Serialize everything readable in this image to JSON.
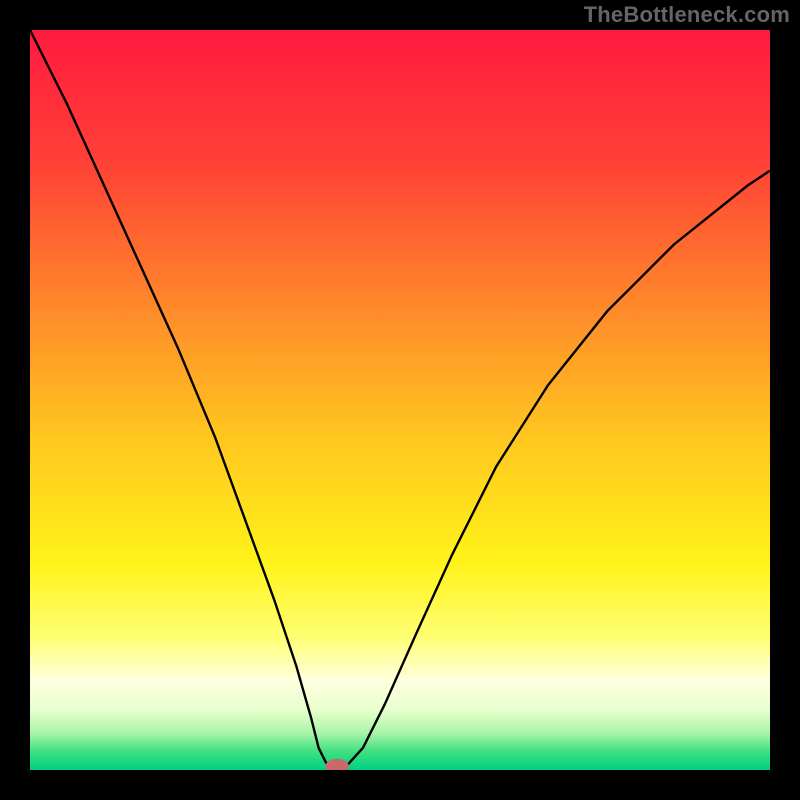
{
  "watermark": "TheBottleneck.com",
  "chart_data": {
    "type": "line",
    "title": "",
    "xlabel": "",
    "ylabel": "",
    "xlim": [
      0,
      100
    ],
    "ylim": [
      0,
      100
    ],
    "grid": false,
    "legend": false,
    "series": [
      {
        "name": "curve",
        "color": "#000000",
        "x": [
          0,
          5,
          10,
          15,
          20,
          25,
          29,
          33,
          36,
          38,
          39,
          40,
          41,
          42,
          43,
          45,
          48,
          52,
          57,
          63,
          70,
          78,
          87,
          97,
          100
        ],
        "y": [
          100,
          90,
          79,
          68,
          57,
          45,
          34,
          23,
          14,
          7,
          3,
          1,
          0.5,
          0.5,
          0.8,
          3,
          9,
          18,
          29,
          41,
          52,
          62,
          71,
          79,
          81
        ]
      }
    ],
    "marker": {
      "name": "highlight",
      "x": 41.5,
      "y": 0.5,
      "rx": 1.6,
      "ry": 1.0,
      "color": "#c86a6a"
    },
    "background_gradient": {
      "stops": [
        {
          "offset": 0.0,
          "color": "#ff1a3f"
        },
        {
          "offset": 0.18,
          "color": "#ff4136"
        },
        {
          "offset": 0.38,
          "color": "#ff8b2a"
        },
        {
          "offset": 0.55,
          "color": "#ffc61f"
        },
        {
          "offset": 0.72,
          "color": "#fff319"
        },
        {
          "offset": 0.82,
          "color": "#ffff73"
        },
        {
          "offset": 0.88,
          "color": "#ffffe0"
        },
        {
          "offset": 0.92,
          "color": "#e6ffcc"
        },
        {
          "offset": 0.95,
          "color": "#a8f5a8"
        },
        {
          "offset": 0.975,
          "color": "#40e080"
        },
        {
          "offset": 1.0,
          "color": "#00d084"
        }
      ]
    }
  }
}
